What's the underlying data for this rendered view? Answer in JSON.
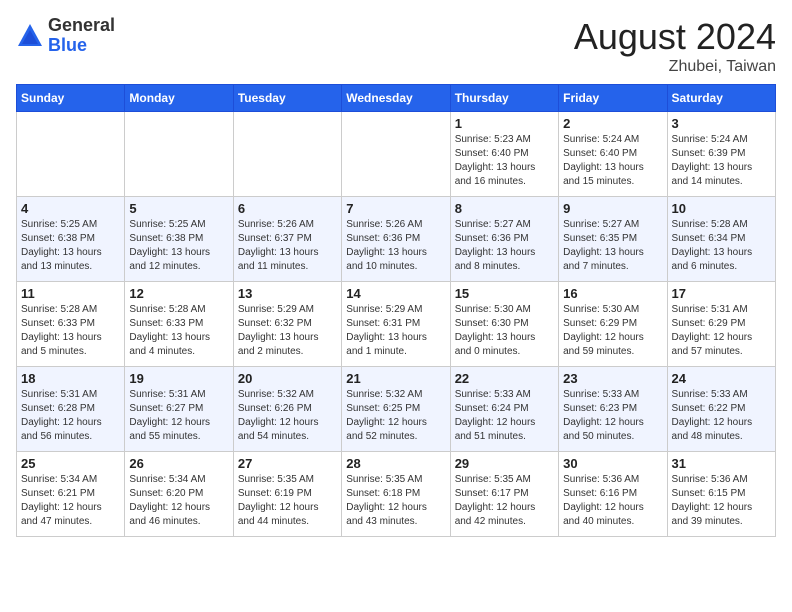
{
  "header": {
    "logo": {
      "general": "General",
      "blue": "Blue"
    },
    "month_year": "August 2024",
    "location": "Zhubei, Taiwan"
  },
  "weekdays": [
    "Sunday",
    "Monday",
    "Tuesday",
    "Wednesday",
    "Thursday",
    "Friday",
    "Saturday"
  ],
  "weeks": [
    [
      {
        "day": "",
        "info": ""
      },
      {
        "day": "",
        "info": ""
      },
      {
        "day": "",
        "info": ""
      },
      {
        "day": "",
        "info": ""
      },
      {
        "day": "1",
        "info": "Sunrise: 5:23 AM\nSunset: 6:40 PM\nDaylight: 13 hours\nand 16 minutes."
      },
      {
        "day": "2",
        "info": "Sunrise: 5:24 AM\nSunset: 6:40 PM\nDaylight: 13 hours\nand 15 minutes."
      },
      {
        "day": "3",
        "info": "Sunrise: 5:24 AM\nSunset: 6:39 PM\nDaylight: 13 hours\nand 14 minutes."
      }
    ],
    [
      {
        "day": "4",
        "info": "Sunrise: 5:25 AM\nSunset: 6:38 PM\nDaylight: 13 hours\nand 13 minutes."
      },
      {
        "day": "5",
        "info": "Sunrise: 5:25 AM\nSunset: 6:38 PM\nDaylight: 13 hours\nand 12 minutes."
      },
      {
        "day": "6",
        "info": "Sunrise: 5:26 AM\nSunset: 6:37 PM\nDaylight: 13 hours\nand 11 minutes."
      },
      {
        "day": "7",
        "info": "Sunrise: 5:26 AM\nSunset: 6:36 PM\nDaylight: 13 hours\nand 10 minutes."
      },
      {
        "day": "8",
        "info": "Sunrise: 5:27 AM\nSunset: 6:36 PM\nDaylight: 13 hours\nand 8 minutes."
      },
      {
        "day": "9",
        "info": "Sunrise: 5:27 AM\nSunset: 6:35 PM\nDaylight: 13 hours\nand 7 minutes."
      },
      {
        "day": "10",
        "info": "Sunrise: 5:28 AM\nSunset: 6:34 PM\nDaylight: 13 hours\nand 6 minutes."
      }
    ],
    [
      {
        "day": "11",
        "info": "Sunrise: 5:28 AM\nSunset: 6:33 PM\nDaylight: 13 hours\nand 5 minutes."
      },
      {
        "day": "12",
        "info": "Sunrise: 5:28 AM\nSunset: 6:33 PM\nDaylight: 13 hours\nand 4 minutes."
      },
      {
        "day": "13",
        "info": "Sunrise: 5:29 AM\nSunset: 6:32 PM\nDaylight: 13 hours\nand 2 minutes."
      },
      {
        "day": "14",
        "info": "Sunrise: 5:29 AM\nSunset: 6:31 PM\nDaylight: 13 hours\nand 1 minute."
      },
      {
        "day": "15",
        "info": "Sunrise: 5:30 AM\nSunset: 6:30 PM\nDaylight: 13 hours\nand 0 minutes."
      },
      {
        "day": "16",
        "info": "Sunrise: 5:30 AM\nSunset: 6:29 PM\nDaylight: 12 hours\nand 59 minutes."
      },
      {
        "day": "17",
        "info": "Sunrise: 5:31 AM\nSunset: 6:29 PM\nDaylight: 12 hours\nand 57 minutes."
      }
    ],
    [
      {
        "day": "18",
        "info": "Sunrise: 5:31 AM\nSunset: 6:28 PM\nDaylight: 12 hours\nand 56 minutes."
      },
      {
        "day": "19",
        "info": "Sunrise: 5:31 AM\nSunset: 6:27 PM\nDaylight: 12 hours\nand 55 minutes."
      },
      {
        "day": "20",
        "info": "Sunrise: 5:32 AM\nSunset: 6:26 PM\nDaylight: 12 hours\nand 54 minutes."
      },
      {
        "day": "21",
        "info": "Sunrise: 5:32 AM\nSunset: 6:25 PM\nDaylight: 12 hours\nand 52 minutes."
      },
      {
        "day": "22",
        "info": "Sunrise: 5:33 AM\nSunset: 6:24 PM\nDaylight: 12 hours\nand 51 minutes."
      },
      {
        "day": "23",
        "info": "Sunrise: 5:33 AM\nSunset: 6:23 PM\nDaylight: 12 hours\nand 50 minutes."
      },
      {
        "day": "24",
        "info": "Sunrise: 5:33 AM\nSunset: 6:22 PM\nDaylight: 12 hours\nand 48 minutes."
      }
    ],
    [
      {
        "day": "25",
        "info": "Sunrise: 5:34 AM\nSunset: 6:21 PM\nDaylight: 12 hours\nand 47 minutes."
      },
      {
        "day": "26",
        "info": "Sunrise: 5:34 AM\nSunset: 6:20 PM\nDaylight: 12 hours\nand 46 minutes."
      },
      {
        "day": "27",
        "info": "Sunrise: 5:35 AM\nSunset: 6:19 PM\nDaylight: 12 hours\nand 44 minutes."
      },
      {
        "day": "28",
        "info": "Sunrise: 5:35 AM\nSunset: 6:18 PM\nDaylight: 12 hours\nand 43 minutes."
      },
      {
        "day": "29",
        "info": "Sunrise: 5:35 AM\nSunset: 6:17 PM\nDaylight: 12 hours\nand 42 minutes."
      },
      {
        "day": "30",
        "info": "Sunrise: 5:36 AM\nSunset: 6:16 PM\nDaylight: 12 hours\nand 40 minutes."
      },
      {
        "day": "31",
        "info": "Sunrise: 5:36 AM\nSunset: 6:15 PM\nDaylight: 12 hours\nand 39 minutes."
      }
    ]
  ]
}
